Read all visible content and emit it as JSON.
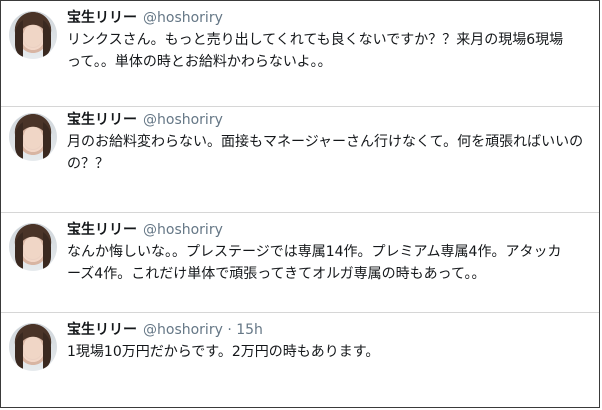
{
  "tweets": [
    {
      "name": "宝生リリー",
      "handle": "@hoshoriry",
      "time": "",
      "lines": [
        "リンクスさん。もっと売り出してくれても良くないですか？？来月の現場6現場",
        "って。。単体の時とお給料かわらないよ。。"
      ]
    },
    {
      "name": "宝生リリー",
      "handle": "@hoshoriry",
      "time": "",
      "lines": [
        "月のお給料変わらない。面接もマネージャーさん行けなくて。何を頑張ればいいの",
        "の？？"
      ]
    },
    {
      "name": "宝生リリー",
      "handle": "@hoshoriry",
      "time": "",
      "lines": [
        "なんか悔しいな。。プレステージでは専属14作。プレミアム専属4作。アタッカ",
        "ーズ4作。これだけ単体で頑張ってきてオルガ専属の時もあって。。"
      ]
    },
    {
      "name": "宝生リリー",
      "handle": "@hoshoriry",
      "time_sep": "·",
      "time": "15h",
      "lines": [
        "1現場10万円だからです。2万円の時もあります。"
      ]
    }
  ]
}
